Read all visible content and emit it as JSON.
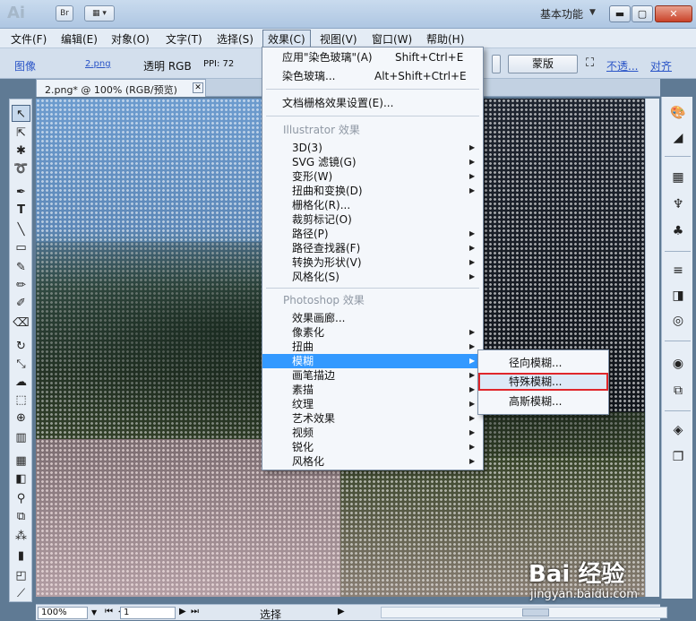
{
  "titlebar": {
    "app_logo": "Ai",
    "bridge_label": "Br",
    "workspace": "基本功能",
    "minimize": "▬",
    "restore": "▢",
    "close": "✕"
  },
  "menubar": {
    "items": [
      "文件(F)",
      "编辑(E)",
      "对象(O)",
      "文字(T)",
      "选择(S)",
      "效果(C)",
      "视图(V)",
      "窗口(W)",
      "帮助(H)"
    ]
  },
  "controlbar": {
    "image": "图像",
    "filename": "2.png",
    "color_mode": "透明 RGB",
    "ppi": "PPI: 72",
    "mask_button": "蒙版",
    "opacity_link": "不透...",
    "align_link": "对齐"
  },
  "document": {
    "tab_label": "2.png* @ 100% (RGB/预览)",
    "tab_close": "✕"
  },
  "statusbar": {
    "zoom": "100%",
    "page": "1",
    "tool": "选择"
  },
  "effects_menu": {
    "apply_last": {
      "label": "应用\"染色玻璃\"(A)",
      "shortcut": "Shift+Ctrl+E"
    },
    "last_effect": {
      "label": "染色玻璃...",
      "shortcut": "Alt+Shift+Ctrl+E"
    },
    "raster_settings": "文档栅格效果设置(E)...",
    "illustrator_header": "Illustrator 效果",
    "illustrator_items": [
      "3D(3)",
      "SVG 滤镜(G)",
      "变形(W)",
      "扭曲和变换(D)",
      "栅格化(R)...",
      "裁剪标记(O)",
      "路径(P)",
      "路径查找器(F)",
      "转换为形状(V)",
      "风格化(S)"
    ],
    "photoshop_header": "Photoshop 效果",
    "photoshop_items": [
      "效果画廊...",
      "像素化",
      "扭曲",
      "模糊",
      "画笔描边",
      "素描",
      "纹理",
      "艺术效果",
      "视频",
      "锐化",
      "风格化"
    ]
  },
  "blur_submenu": {
    "items": [
      "径向模糊...",
      "特殊模糊...",
      "高斯模糊..."
    ],
    "selected": "特殊模糊..."
  },
  "watermark": {
    "logo": "Bai 经验",
    "url": "jingyan.baidu.com"
  }
}
